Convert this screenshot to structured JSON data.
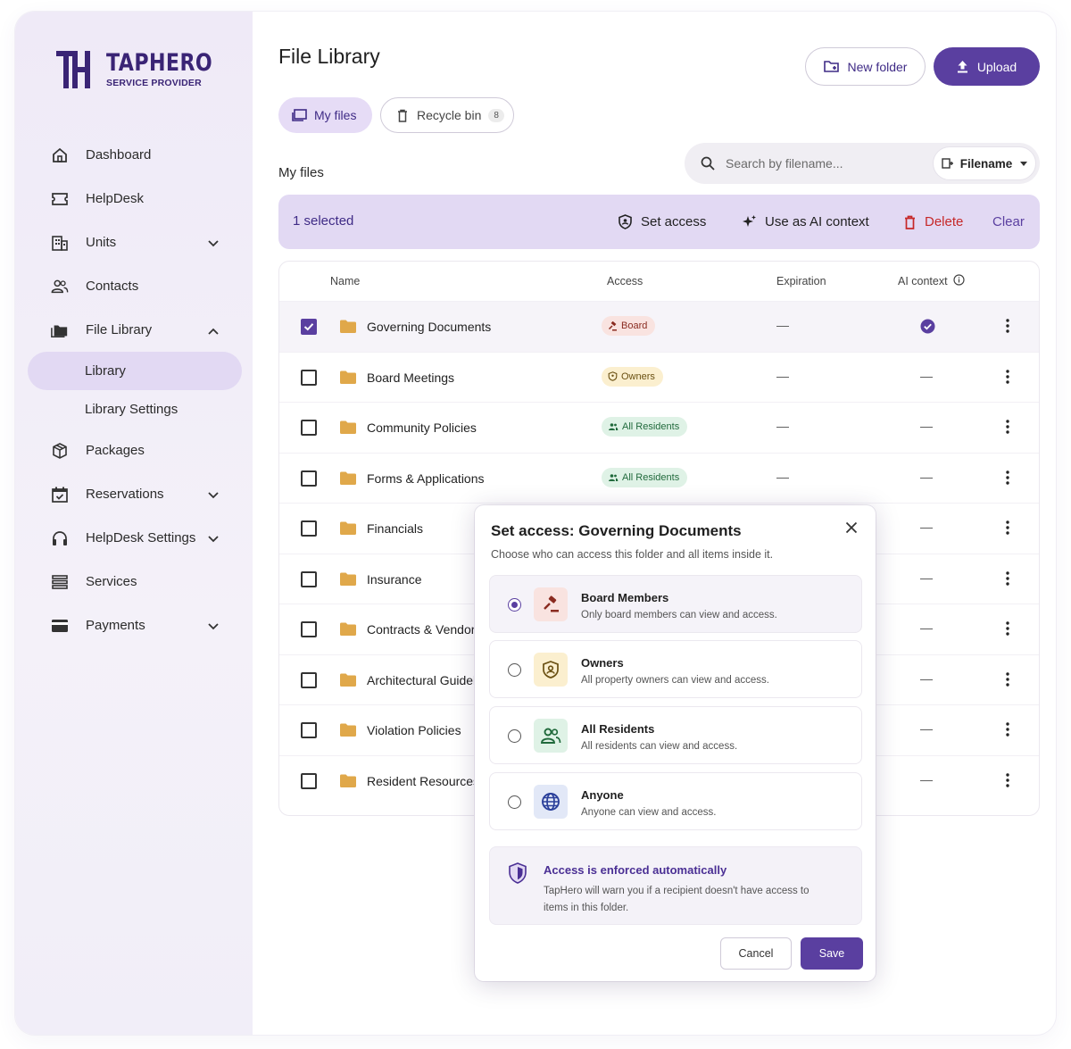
{
  "brand": {
    "name": "TAPHERO",
    "subtitle": "SERVICE PROVIDER"
  },
  "sidebar": {
    "items": [
      {
        "label": "Dashboard",
        "icon": "home-icon"
      },
      {
        "label": "HelpDesk",
        "icon": "ticket-icon"
      },
      {
        "label": "Units",
        "icon": "building-icon",
        "expandable": true
      },
      {
        "label": "Contacts",
        "icon": "people-icon"
      },
      {
        "label": "File Library",
        "icon": "folder-icon",
        "expanded": true
      },
      {
        "label": "Packages",
        "icon": "package-icon"
      },
      {
        "label": "Reservations",
        "icon": "calendar-check-icon",
        "expandable": true
      },
      {
        "label": "HelpDesk Settings",
        "icon": "headset-icon",
        "expandable": true
      },
      {
        "label": "Services",
        "icon": "services-icon"
      },
      {
        "label": "Payments",
        "icon": "card-icon",
        "expandable": true
      }
    ],
    "sub_items": [
      {
        "label": "Library",
        "active": true
      },
      {
        "label": "Library Settings"
      }
    ]
  },
  "header": {
    "title": "File Library",
    "new_folder_label": "New folder",
    "upload_label": "Upload"
  },
  "tabs": [
    {
      "label": "My files",
      "active": true
    },
    {
      "label": "Recycle bin",
      "count": "8"
    }
  ],
  "section_label": "My files",
  "search": {
    "placeholder": "Search by filename...",
    "sort_label": "Filename"
  },
  "selection_bar": {
    "count_label": "1 selected",
    "set_access": "Set access",
    "ai_context": "Use as AI context",
    "delete": "Delete",
    "clear": "Clear"
  },
  "table": {
    "columns": [
      "Name",
      "Access",
      "Expiration",
      "AI context"
    ],
    "rows": [
      {
        "name": "Governing Documents",
        "access": "Board",
        "access_type": "board",
        "expiration": "—",
        "ai": "check",
        "selected": true
      },
      {
        "name": "Board Meetings",
        "access": "Owners",
        "access_type": "owners",
        "expiration": "—",
        "ai": "—"
      },
      {
        "name": "Community Policies",
        "access": "All Residents",
        "access_type": "res",
        "expiration": "—",
        "ai": "—"
      },
      {
        "name": "Forms & Applications",
        "access": "All Residents",
        "access_type": "res",
        "expiration": "—",
        "ai": "—"
      },
      {
        "name": "Financials",
        "ai": "—"
      },
      {
        "name": "Insurance",
        "ai": "—"
      },
      {
        "name": "Contracts & Vendors",
        "ai": "—"
      },
      {
        "name": "Architectural Guideli",
        "ai": "—"
      },
      {
        "name": "Violation Policies",
        "ai": "—"
      },
      {
        "name": "Resident Resources",
        "ai": "—"
      }
    ]
  },
  "dialog": {
    "title": "Set access: Governing Documents",
    "subtitle": "Choose who can access this folder and all items inside it.",
    "options": [
      {
        "title": "Board Members",
        "desc": "Only board members can view and access.",
        "selected": true,
        "icon": "gavel-icon",
        "tint": "#f9e3e0"
      },
      {
        "title": "Owners",
        "desc": "All property owners can view and access.",
        "icon": "owner-badge-icon",
        "tint": "#fbefcf"
      },
      {
        "title": "All Residents",
        "desc": "All residents can view and access.",
        "icon": "residents-icon",
        "tint": "#dff2e6"
      },
      {
        "title": "Anyone",
        "desc": "Anyone can view and access.",
        "icon": "globe-icon",
        "tint": "#e2e8f7"
      }
    ],
    "note_title": "Access is enforced automatically",
    "note_desc": "TapHero will warn you if a recipient doesn't have access to items in this folder.",
    "cancel": "Cancel",
    "save": "Save"
  },
  "colors": {
    "accent": "#5a3fa0",
    "selection": "#e2d9f3",
    "sidebar": "#efeaf7",
    "delete": "#c62828"
  }
}
